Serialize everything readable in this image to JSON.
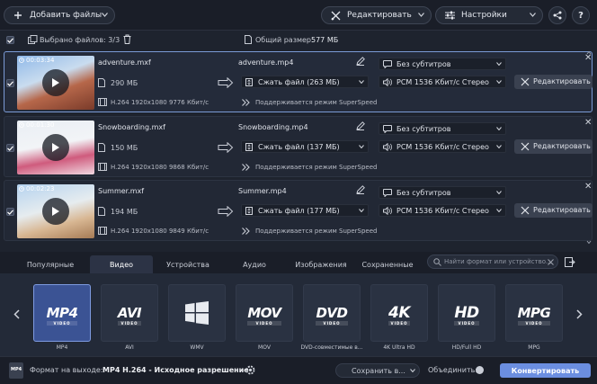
{
  "toolbar": {
    "add_files": "Добавить файлы",
    "edit": "Редактировать",
    "settings": "Настройки"
  },
  "infobar": {
    "selected": "Выбрано файлов: 3/3",
    "total_label": "Общий размер:",
    "total_value": "577 МБ"
  },
  "files": [
    {
      "duration": "00:03:34",
      "src_name": "adventure.mxf",
      "src_size": "290 МБ",
      "src_codec": "H.264 1920x1080 9776 Кбит/с",
      "out_name": "adventure.mp4",
      "compress": "Сжать файл (263 МБ)",
      "superspeed": "Поддерживается режим SuperSpeed",
      "subtitles": "Без субтитров",
      "audio": "PCM 1536 Кбит/с Стерео",
      "edit": "Редактировать"
    },
    {
      "duration": "00:01:30",
      "src_name": "Snowboarding.mxf",
      "src_size": "150 МБ",
      "src_codec": "H.264 1920x1080 9868 Кбит/с",
      "out_name": "Snowboarding.mp4",
      "compress": "Сжать файл (137 МБ)",
      "superspeed": "Поддерживается режим SuperSpeed",
      "subtitles": "Без субтитров",
      "audio": "PCM 1536 Кбит/с Стерео",
      "edit": "Редактировать"
    },
    {
      "duration": "00:02:23",
      "src_name": "Summer.mxf",
      "src_size": "194 МБ",
      "src_codec": "H.264 1920x1080 9849 Кбит/с",
      "out_name": "Summer.mp4",
      "compress": "Сжать файл (177 МБ)",
      "superspeed": "Поддерживается режим SuperSpeed",
      "subtitles": "Без субтитров",
      "audio": "PCM 1536 Кбит/с Стерео",
      "edit": "Редактировать"
    }
  ],
  "tabs": [
    "Популярные",
    "Видео",
    "Устройства",
    "Аудио",
    "Изображения",
    "Сохраненные"
  ],
  "active_tab": "Видео",
  "search": {
    "placeholder": "Найти формат или устройство..."
  },
  "formats": [
    {
      "logo": "MP4",
      "sub": "VIDEO",
      "label": "MP4"
    },
    {
      "logo": "AVI",
      "sub": "VIDEO",
      "label": "AVI"
    },
    {
      "logo": "",
      "sub": "",
      "label": "WMV"
    },
    {
      "logo": "MOV",
      "sub": "VIDEO",
      "label": "MOV"
    },
    {
      "logo": "DVD",
      "sub": "VIDEO",
      "label": "DVD-совместимые в..."
    },
    {
      "logo": "4K",
      "sub": "VIDEO",
      "label": "4K Ultra HD"
    },
    {
      "logo": "HD",
      "sub": "VIDEO",
      "label": "HD/Full HD"
    },
    {
      "logo": "MPG",
      "sub": "VIDEO",
      "label": "MPG"
    }
  ],
  "bottom": {
    "output_label": "Формат на выходе:",
    "output_value": "MP4 H.264 - Исходное разрешение",
    "save_to": "Сохранить в...",
    "merge": "Объединить:",
    "convert": "Конвертировать",
    "format_badge": "MP4"
  },
  "colors": {
    "accent": "#6b8ee0",
    "selected_format": "#3b5394",
    "background": "#1e232e"
  }
}
